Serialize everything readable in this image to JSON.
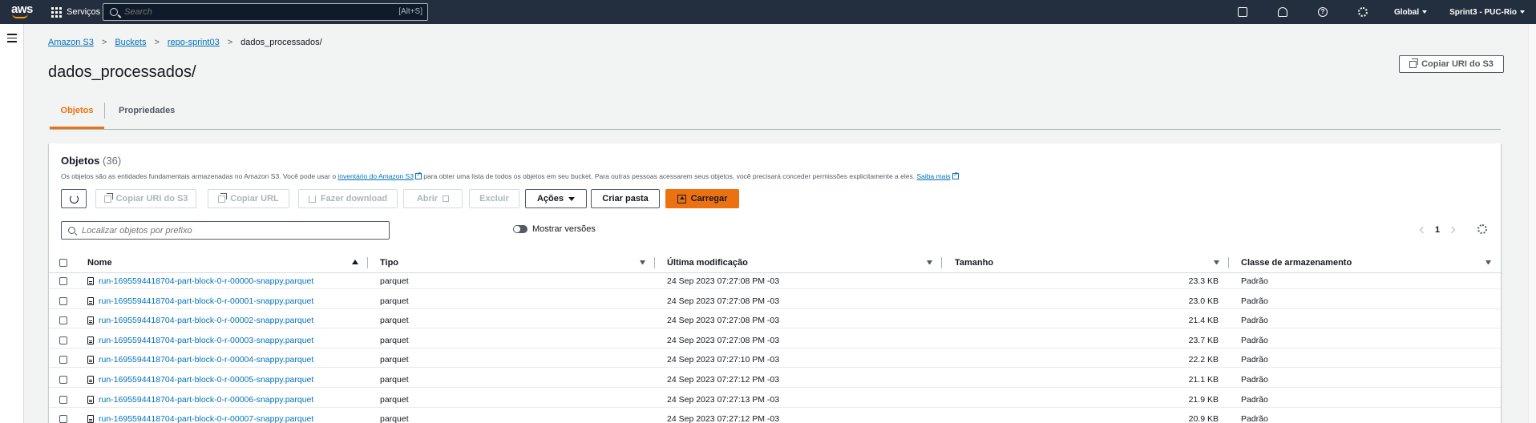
{
  "nav": {
    "logo_text": "aws",
    "services_label": "Serviços",
    "search_placeholder": "Search",
    "search_shortcut": "[Alt+S]",
    "region": "Global",
    "account": "Sprint3 - PUC-Rio",
    "icons": [
      "cloudshell-icon",
      "bell-icon",
      "help-icon",
      "gear-icon"
    ]
  },
  "breadcrumb": {
    "items": [
      "Amazon S3",
      "Buckets",
      "repo-sprint03"
    ],
    "current": "dados_processados/"
  },
  "page": {
    "title": "dados_processados/",
    "copy_uri_label": "Copiar URI do S3"
  },
  "tabs": [
    {
      "label": "Objetos",
      "active": true
    },
    {
      "label": "Propriedades",
      "active": false
    }
  ],
  "objects": {
    "title": "Objetos",
    "count": "(36)",
    "desc_prefix": "Os objetos são as entidades fundamentais armazenadas no Amazon S3. Você pode usar o ",
    "desc_link1": "inventário do Amazon S3",
    "desc_middle": " para obter uma lista de todos os objetos em seu bucket. Para outras pessoas acessarem seus objetos, você precisará conceder permissões explicitamente a eles. ",
    "desc_link2": "Saiba mais",
    "buttons": {
      "copy_uri": "Copiar URI do S3",
      "copy_url": "Copiar URL",
      "download": "Fazer download",
      "open": "Abrir",
      "delete": "Excluir",
      "actions": "Ações",
      "create_folder": "Criar pasta",
      "upload": "Carregar"
    },
    "filter_placeholder": "Localizar objetos por prefixo",
    "versions_label": "Mostrar versões",
    "page_number": "1",
    "columns": [
      "Nome",
      "Tipo",
      "Última modificação",
      "Tamanho",
      "Classe de armazenamento"
    ],
    "rows": [
      {
        "name": "run-1695594418704-part-block-0-r-00000-snappy.parquet",
        "type": "parquet",
        "modified": "24 Sep 2023 07:27:08 PM -03",
        "size": "23.3 KB",
        "class": "Padrão"
      },
      {
        "name": "run-1695594418704-part-block-0-r-00001-snappy.parquet",
        "type": "parquet",
        "modified": "24 Sep 2023 07:27:08 PM -03",
        "size": "23.0 KB",
        "class": "Padrão"
      },
      {
        "name": "run-1695594418704-part-block-0-r-00002-snappy.parquet",
        "type": "parquet",
        "modified": "24 Sep 2023 07:27:08 PM -03",
        "size": "21.4 KB",
        "class": "Padrão"
      },
      {
        "name": "run-1695594418704-part-block-0-r-00003-snappy.parquet",
        "type": "parquet",
        "modified": "24 Sep 2023 07:27:08 PM -03",
        "size": "23.7 KB",
        "class": "Padrão"
      },
      {
        "name": "run-1695594418704-part-block-0-r-00004-snappy.parquet",
        "type": "parquet",
        "modified": "24 Sep 2023 07:27:10 PM -03",
        "size": "22.2 KB",
        "class": "Padrão"
      },
      {
        "name": "run-1695594418704-part-block-0-r-00005-snappy.parquet",
        "type": "parquet",
        "modified": "24 Sep 2023 07:27:12 PM -03",
        "size": "21.1 KB",
        "class": "Padrão"
      },
      {
        "name": "run-1695594418704-part-block-0-r-00006-snappy.parquet",
        "type": "parquet",
        "modified": "24 Sep 2023 07:27:13 PM -03",
        "size": "21.9 KB",
        "class": "Padrão"
      },
      {
        "name": "run-1695594418704-part-block-0-r-00007-snappy.parquet",
        "type": "parquet",
        "modified": "24 Sep 2023 07:27:12 PM -03",
        "size": "20.9 KB",
        "class": "Padrão"
      }
    ]
  },
  "colors": {
    "nav_bg": "#232f3e",
    "accent_orange": "#ec7211",
    "link_blue": "#0073bb"
  }
}
